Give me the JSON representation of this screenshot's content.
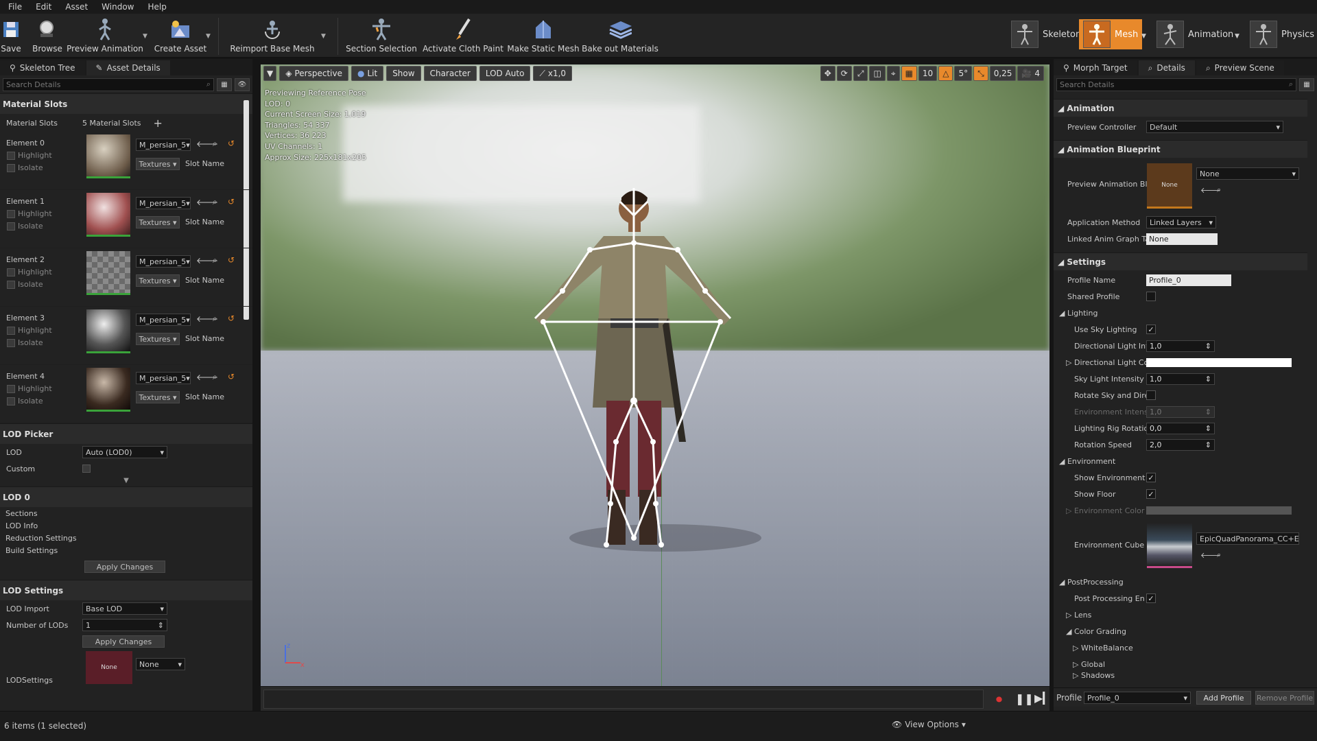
{
  "menu": [
    "File",
    "Edit",
    "Asset",
    "Window",
    "Help"
  ],
  "toolbar": {
    "save": "Save",
    "browse": "Browse",
    "preview_animation": "Preview Animation",
    "create_asset": "Create Asset",
    "reimport": "Reimport Base Mesh",
    "section_selection": "Section Selection",
    "cloth_paint": "Activate Cloth Paint",
    "make_static": "Make Static Mesh",
    "bake_materials": "Bake out Materials",
    "modes": {
      "skeleton": "Skeleton",
      "mesh": "Mesh",
      "animation": "Animation",
      "physics": "Physics"
    }
  },
  "left": {
    "tabs": [
      "Skeleton Tree",
      "Asset Details"
    ],
    "search_placeholder": "Search Details",
    "material_slots": {
      "header": "Material Slots",
      "label": "Material Slots",
      "count": "5 Material Slots",
      "elements": [
        {
          "name": "Element 0",
          "material": "M_persian_5",
          "textures": "Textures",
          "slot": "Slot Name"
        },
        {
          "name": "Element 1",
          "material": "M_persian_5",
          "textures": "Textures",
          "slot": "Slot Name"
        },
        {
          "name": "Element 2",
          "material": "M_persian_5",
          "textures": "Textures",
          "slot": "Slot Name"
        },
        {
          "name": "Element 3",
          "material": "M_persian_5",
          "textures": "Textures",
          "slot": "Slot Name"
        },
        {
          "name": "Element 4",
          "material": "M_persian_5",
          "textures": "Textures",
          "slot": "Slot Name"
        }
      ],
      "highlight": "Highlight",
      "isolate": "Isolate"
    },
    "lod_picker": {
      "header": "LOD Picker",
      "lod_label": "LOD",
      "lod_value": "Auto (LOD0)",
      "custom": "Custom"
    },
    "lod0": {
      "header": "LOD 0",
      "items": [
        "Sections",
        "LOD Info",
        "Reduction Settings",
        "Build Settings"
      ],
      "apply": "Apply Changes"
    },
    "lod_settings": {
      "header": "LOD Settings",
      "import_label": "LOD Import",
      "import_value": "Base LOD",
      "num_label": "Number of LODs",
      "num_value": "1",
      "apply": "Apply Changes",
      "lodsettings_label": "LODSettings",
      "none_thumb": "None",
      "none_combo": "None"
    }
  },
  "viewport": {
    "perspective": "Perspective",
    "lit": "Lit",
    "show": "Show",
    "character": "Character",
    "lod_auto": "LOD Auto",
    "speed": "x1,0",
    "grid": "10",
    "angle": "5°",
    "scale": "0,25",
    "camera_speed": "4",
    "stats": [
      "Previewing Reference Pose",
      "LOD: 0",
      "Current Screen Size: 1,019",
      "Triangles: 54 337",
      "Vertices: 36 223",
      "UV Channels: 1",
      "Approx Size: 225x181x205"
    ]
  },
  "right": {
    "tabs": [
      "Morph Target",
      "Details",
      "Preview Scene"
    ],
    "search_placeholder": "Search Details",
    "animation": {
      "header": "Animation",
      "preview_controller_label": "Preview Controller",
      "preview_controller_value": "Default"
    },
    "anim_bp": {
      "header": "Animation Blueprint",
      "preview_label": "Preview Animation Bl",
      "thumb": "None",
      "combo": "None",
      "app_method_label": "Application Method",
      "app_method_value": "Linked Layers",
      "linked_label": "Linked Anim Graph Ta",
      "linked_value": "None"
    },
    "settings": {
      "header": "Settings",
      "profile_name_label": "Profile Name",
      "profile_name_value": "Profile_0",
      "shared_profile": "Shared Profile",
      "lighting": "Lighting",
      "use_sky": "Use Sky Lighting",
      "dir_int": "Directional Light Int",
      "dir_int_val": "1,0",
      "dir_col": "Directional Light Co",
      "sky_int": "Sky Light Intensity",
      "sky_int_val": "1,0",
      "rotate_sky": "Rotate Sky and Dire",
      "env_int": "Environment Intensi",
      "env_int_val": "1,0",
      "rig_rot": "Lighting Rig Rotatio",
      "rig_rot_val": "0,0",
      "rot_speed": "Rotation Speed",
      "rot_speed_val": "2,0",
      "environment": "Environment",
      "show_env": "Show Environment",
      "show_floor": "Show Floor",
      "env_color": "Environment Color",
      "env_cube": "Environment Cube M",
      "env_cube_val": "EpicQuadPanorama_CC+E",
      "postprocessing": "PostProcessing",
      "pp_enabled": "Post Processing En",
      "lens": "Lens",
      "color_grading": "Color Grading",
      "white_balance": "WhiteBalance",
      "global": "Global",
      "shadows": "Shadows"
    },
    "profile": {
      "label": "Profile",
      "value": "Profile_0",
      "add": "Add Profile",
      "remove": "Remove Profile"
    }
  },
  "status": {
    "items": "6 items (1 selected)",
    "view_options": "View Options"
  }
}
